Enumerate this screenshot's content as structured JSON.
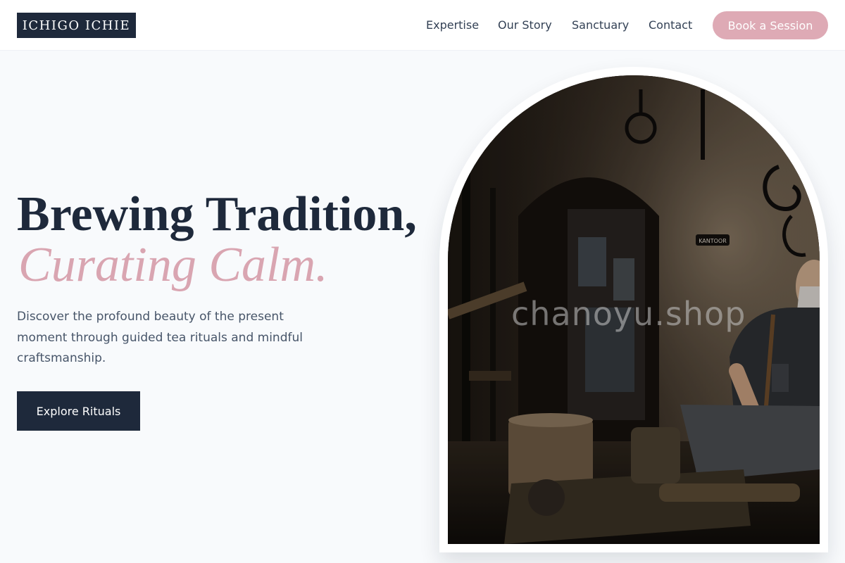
{
  "header": {
    "logo": "ICHIGO ICHIE",
    "nav": {
      "expertise": "Expertise",
      "our_story": "Our Story",
      "sanctuary": "Sanctuary",
      "contact": "Contact"
    },
    "cta": "Book a Session"
  },
  "hero": {
    "headline_line1": "Brewing Tradition,",
    "headline_line2": "Curating Calm.",
    "description": "Discover the profound beauty of the present moment through guided tea rituals and mindful craftsmanship.",
    "button": "Explore Rituals"
  },
  "image": {
    "watermark": "chanoyu.shop",
    "sign": "KANTOOR"
  },
  "colors": {
    "navy": "#1e293b",
    "pink": "#deaab5",
    "background": "#f8fafc"
  }
}
